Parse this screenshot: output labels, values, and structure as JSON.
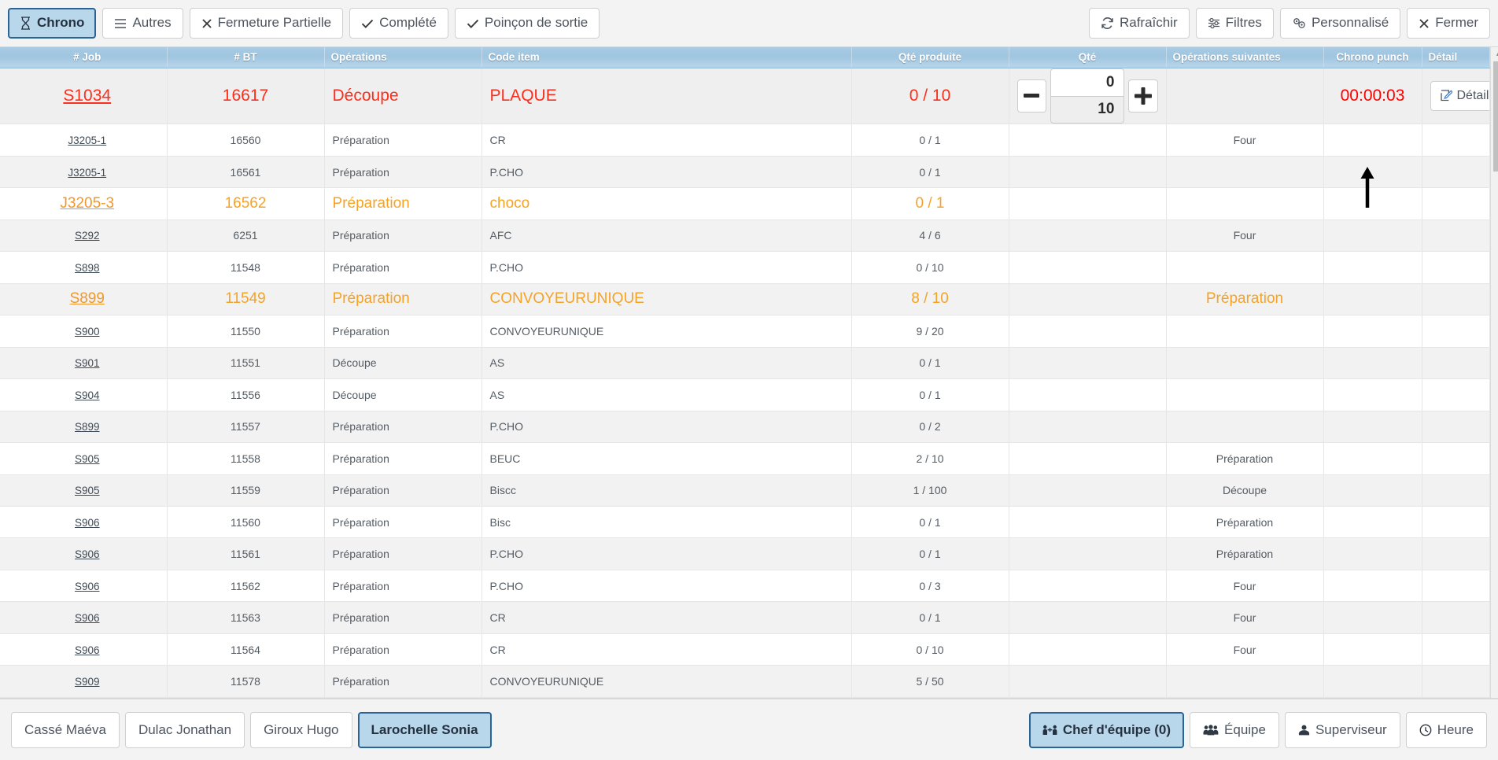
{
  "toolbar": {
    "left_buttons": [
      {
        "label": "Chrono",
        "icon": "hourglass-icon",
        "active": true
      },
      {
        "label": "Autres",
        "icon": "menu-icon",
        "active": false
      },
      {
        "label": "Fermeture Partielle",
        "icon": "close-icon",
        "active": false
      },
      {
        "label": "Complété",
        "icon": "check-icon",
        "active": false
      },
      {
        "label": "Poinçon de sortie",
        "icon": "check-icon",
        "active": false
      }
    ],
    "right_buttons": [
      {
        "label": "Rafraîchir",
        "icon": "refresh-icon"
      },
      {
        "label": "Filtres",
        "icon": "sliders-icon"
      },
      {
        "label": "Personnalisé",
        "icon": "gears-icon"
      },
      {
        "label": "Fermer",
        "icon": "close-icon"
      }
    ]
  },
  "table": {
    "columns": [
      "# Job",
      "# BT",
      "Opérations",
      "Code item",
      "Qté produite",
      "Qté",
      "Opérations suivantes",
      "Chrono punch",
      "Détail"
    ],
    "detail_button_label": "Détail",
    "stepper": {
      "minus_label": "−",
      "plus_label": "+",
      "value": "0",
      "total": "10"
    },
    "rows": [
      {
        "job": "S1034",
        "bt": "16617",
        "op": "Découpe",
        "code": "PLAQUE",
        "produite": "0 / 10",
        "next": "",
        "chrono": "00:00:03",
        "style": "red",
        "has_stepper": true,
        "has_detail": true
      },
      {
        "job": "J3205-1",
        "bt": "16560",
        "op": "Préparation",
        "code": "CR",
        "produite": "0 / 1",
        "next": "Four",
        "chrono": "",
        "style": "normal",
        "has_stepper": false,
        "has_detail": false
      },
      {
        "job": "J3205-1",
        "bt": "16561",
        "op": "Préparation",
        "code": "P.CHO",
        "produite": "0 / 1",
        "next": "",
        "chrono": "",
        "style": "alt",
        "has_stepper": false,
        "has_detail": false
      },
      {
        "job": "J3205-3",
        "bt": "16562",
        "op": "Préparation",
        "code": "choco",
        "produite": "0 / 1",
        "next": "",
        "chrono": "",
        "style": "orange",
        "has_stepper": false,
        "has_detail": false
      },
      {
        "job": "S292",
        "bt": "6251",
        "op": "Préparation",
        "code": "AFC",
        "produite": "4 / 6",
        "next": "Four",
        "chrono": "",
        "style": "alt",
        "has_stepper": false,
        "has_detail": false
      },
      {
        "job": "S898",
        "bt": "11548",
        "op": "Préparation",
        "code": "P.CHO",
        "produite": "0 / 10",
        "next": "",
        "chrono": "",
        "style": "normal",
        "has_stepper": false,
        "has_detail": false
      },
      {
        "job": "S899",
        "bt": "11549",
        "op": "Préparation",
        "code": "CONVOYEURUNIQUE",
        "produite": "8 / 10",
        "next": "Préparation",
        "chrono": "",
        "style": "orange-alt",
        "has_stepper": false,
        "has_detail": false
      },
      {
        "job": "S900",
        "bt": "11550",
        "op": "Préparation",
        "code": "CONVOYEURUNIQUE",
        "produite": "9 / 20",
        "next": "",
        "chrono": "",
        "style": "normal",
        "has_stepper": false,
        "has_detail": false
      },
      {
        "job": "S901",
        "bt": "11551",
        "op": "Découpe",
        "code": "AS",
        "produite": "0 / 1",
        "next": "",
        "chrono": "",
        "style": "alt",
        "has_stepper": false,
        "has_detail": false
      },
      {
        "job": "S904",
        "bt": "11556",
        "op": "Découpe",
        "code": "AS",
        "produite": "0 / 1",
        "next": "",
        "chrono": "",
        "style": "normal",
        "has_stepper": false,
        "has_detail": false
      },
      {
        "job": "S899",
        "bt": "11557",
        "op": "Préparation",
        "code": "P.CHO",
        "produite": "0 / 2",
        "next": "",
        "chrono": "",
        "style": "alt",
        "has_stepper": false,
        "has_detail": false
      },
      {
        "job": "S905",
        "bt": "11558",
        "op": "Préparation",
        "code": "BEUC",
        "produite": "2 / 10",
        "next": "Préparation",
        "chrono": "",
        "style": "normal",
        "has_stepper": false,
        "has_detail": false
      },
      {
        "job": "S905",
        "bt": "11559",
        "op": "Préparation",
        "code": "Biscc",
        "produite": "1 / 100",
        "next": "Découpe",
        "chrono": "",
        "style": "alt",
        "has_stepper": false,
        "has_detail": false
      },
      {
        "job": "S906",
        "bt": "11560",
        "op": "Préparation",
        "code": "Bisc",
        "produite": "0 / 1",
        "next": "Préparation",
        "chrono": "",
        "style": "normal",
        "has_stepper": false,
        "has_detail": false
      },
      {
        "job": "S906",
        "bt": "11561",
        "op": "Préparation",
        "code": "P.CHO",
        "produite": "0 / 1",
        "next": "Préparation",
        "chrono": "",
        "style": "alt",
        "has_stepper": false,
        "has_detail": false
      },
      {
        "job": "S906",
        "bt": "11562",
        "op": "Préparation",
        "code": "P.CHO",
        "produite": "0 / 3",
        "next": "Four",
        "chrono": "",
        "style": "normal",
        "has_stepper": false,
        "has_detail": false
      },
      {
        "job": "S906",
        "bt": "11563",
        "op": "Préparation",
        "code": "CR",
        "produite": "0 / 1",
        "next": "Four",
        "chrono": "",
        "style": "alt",
        "has_stepper": false,
        "has_detail": false
      },
      {
        "job": "S906",
        "bt": "11564",
        "op": "Préparation",
        "code": "CR",
        "produite": "0 / 10",
        "next": "Four",
        "chrono": "",
        "style": "normal",
        "has_stepper": false,
        "has_detail": false
      },
      {
        "job": "S909",
        "bt": "11578",
        "op": "Préparation",
        "code": "CONVOYEURUNIQUE",
        "produite": "5 / 50",
        "next": "",
        "chrono": "",
        "style": "alt",
        "has_stepper": false,
        "has_detail": false
      }
    ]
  },
  "bottombar": {
    "employees": [
      {
        "label": "Cassé Maéva",
        "active": false
      },
      {
        "label": "Dulac Jonathan",
        "active": false
      },
      {
        "label": "Giroux Hugo",
        "active": false
      },
      {
        "label": "Larochelle Sonia",
        "active": true
      }
    ],
    "actions": [
      {
        "label": "Chef d'équipe (0)",
        "icon": "team-lead-icon",
        "active": true
      },
      {
        "label": "Équipe",
        "icon": "users-icon",
        "active": false
      },
      {
        "label": "Superviseur",
        "icon": "user-icon",
        "active": false
      },
      {
        "label": "Heure",
        "icon": "clock-icon",
        "active": false
      }
    ]
  },
  "colors": {
    "accent_blue": "#b9d7ea",
    "accent_border": "#2a6496",
    "header_blue": "#9fc5e0",
    "alert_red": "#fc2e1c",
    "warn_orange": "#f5a326"
  }
}
